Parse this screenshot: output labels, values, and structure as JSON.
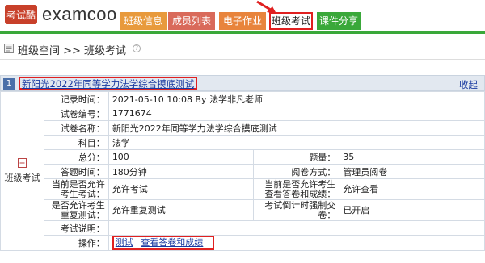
{
  "header": {
    "logo_seal_text": "考试酷",
    "brand": "examcoo",
    "tabs": [
      {
        "label": "班级信息"
      },
      {
        "label": "成员列表"
      },
      {
        "label": "电子作业"
      },
      {
        "label": "班级考试"
      },
      {
        "label": "课件分享"
      }
    ],
    "active_tab": "班级考试"
  },
  "breadcrumb": {
    "text": "班级空间 >> 班级考试"
  },
  "exam": {
    "index": "1",
    "title": "新阳光2022年同等学力法学综合摸底测试",
    "collapse_label": "收起",
    "side_label": "班级考试",
    "fields": {
      "record_time_label": "记录时间：",
      "record_time_value": "2021-05-10 10:08  By 法学非凡老师",
      "paper_no_label": "试卷编号：",
      "paper_no_value": "1771674",
      "paper_name_label": "试卷名称：",
      "paper_name_value": "新阳光2022年同等学力法学综合摸底测试",
      "subject_label": "科目：",
      "subject_value": "法学",
      "total_label": "总分：",
      "total_value": "100",
      "questions_label": "题量：",
      "questions_value": "35",
      "duration_label": "答题时间：",
      "duration_value": "180分钟",
      "grading_label": "阅卷方式：",
      "grading_value": "管理员阅卷",
      "allow_exam_label": "当前是否允许考生考试：",
      "allow_exam_value": "允许考试",
      "allow_view_label": "当前是否允许考生查看答卷和成绩：",
      "allow_view_value": "允许查看",
      "allow_retest_label": "是否允许考生重复测试：",
      "allow_retest_value": "允许重复测试",
      "countdown_label": "考试倒计时强制交卷：",
      "countdown_value": "已开启",
      "desc_label": "考试说明：",
      "desc_value": "",
      "ops_label": "操作：",
      "op_test": "测试",
      "op_view": "查看答卷和成绩"
    }
  },
  "colors": {
    "tab_info": "#e89a3c",
    "tab_members": "#d96a5a",
    "tab_homework": "#e8843c",
    "tab_share": "#3aa83a",
    "highlight": "#e02020",
    "link": "#1a3aa0"
  }
}
